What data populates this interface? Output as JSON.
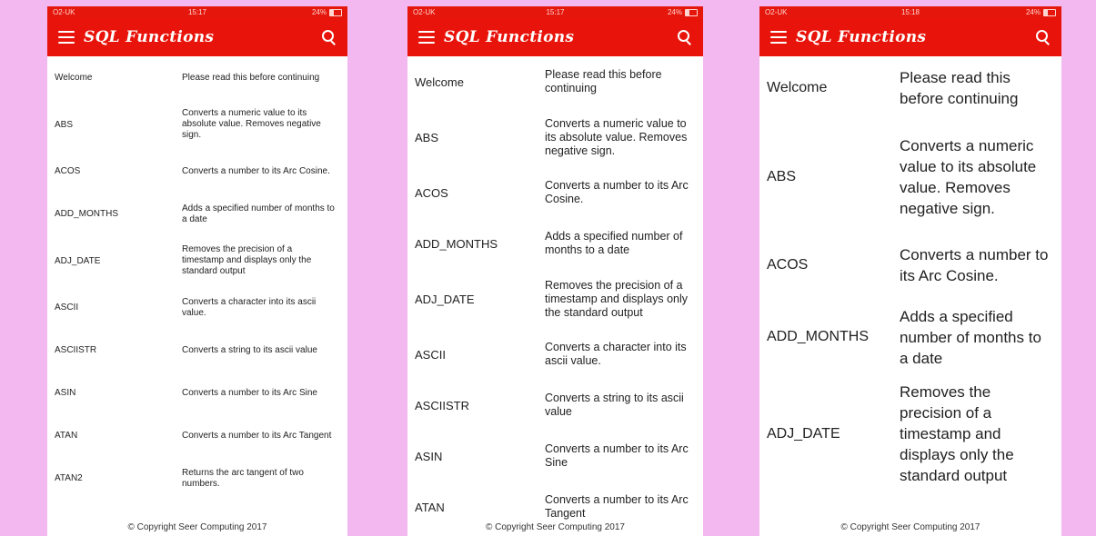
{
  "status": {
    "carrier": "O2-UK",
    "battery": "24%",
    "times": [
      "15:17",
      "15:17",
      "15:18"
    ]
  },
  "app": {
    "title": "SQL Functions",
    "footer": "© Copyright Seer Computing 2017"
  },
  "items": [
    {
      "name": "Welcome",
      "desc": "Please read this before continuing"
    },
    {
      "name": "ABS",
      "desc": "Converts a numeric value to its absolute value. Removes negative sign."
    },
    {
      "name": "ACOS",
      "desc": "Converts a number to its Arc Cosine."
    },
    {
      "name": "ADD_MONTHS",
      "desc": "Adds a specified number of months to a date"
    },
    {
      "name": "ADJ_DATE",
      "desc": "Removes the precision of a timestamp and displays only the standard output"
    },
    {
      "name": "ASCII",
      "desc": "Converts a character into its ascii value."
    },
    {
      "name": "ASCIISTR",
      "desc": "Converts a string to its ascii value"
    },
    {
      "name": "ASIN",
      "desc": "Converts a number to its Arc Sine"
    },
    {
      "name": "ATAN",
      "desc": "Converts a number to its Arc Tangent"
    },
    {
      "name": "ATAN2",
      "desc": "Returns the arc tangent of two numbers."
    }
  ],
  "colors": {
    "brand_red": "#e8140b",
    "background": "#f2b8ef"
  },
  "icons": {
    "menu": "menu-icon",
    "search": "search-icon",
    "battery": "battery-icon"
  }
}
